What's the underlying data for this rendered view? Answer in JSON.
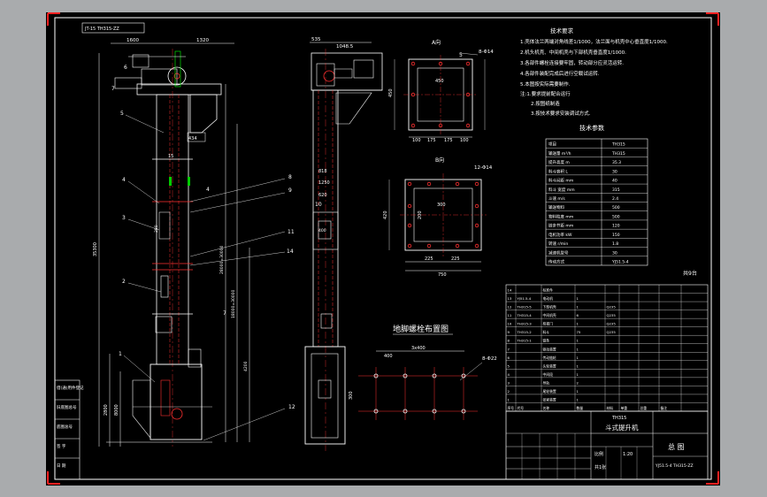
{
  "drawing_code": "JT-15 TH315-ZZ",
  "notes": {
    "title": "技术要求",
    "items": [
      "1.壳体法兰两端对角线差1/1000，法兰面与机壳中心垂直度1/1000.",
      "2.机头机壳、中间机壳与下部机壳垂直度1/1000.",
      "3.各部件螺栓连接要牢固，转动部分应灵活运转.",
      "4.各部件装配完成后进行空载试运转.",
      "5.本图按实际需要制作."
    ],
    "sub_items": [
      "注:1.要求提前配合运行",
      "2.按图纸制造",
      "3.按技术要求安装调试方式."
    ]
  },
  "tech_table": {
    "title": "技术参数",
    "header": [
      "项目",
      "TH315"
    ],
    "rows": [
      [
        "输送量 m³/h",
        "TH315"
      ],
      [
        "提升高度 m",
        "35.3"
      ],
      [
        "料斗容积 L",
        "30"
      ],
      [
        "料斗间距 mm",
        "40"
      ],
      [
        "料斗 宽度 mm",
        "315"
      ],
      [
        "斗速 m/s",
        "2.4"
      ],
      [
        "输送物料",
        "500"
      ],
      [
        "物料粒度 mm",
        "500"
      ],
      [
        "链条节距 mm",
        "120"
      ],
      [
        "电机功率 kW",
        "150"
      ],
      [
        "转速 r/min",
        "1.8"
      ],
      [
        "减速机型号",
        "30"
      ],
      [
        "传动方式",
        "YJ51.5-4"
      ]
    ]
  },
  "view_labels": {
    "a": "A向",
    "b": "B向",
    "anchor": "地脚螺栓布置图"
  },
  "dims": {
    "total": "1600",
    "width": "1320",
    "head_w": "1048.5",
    "head_l": "535",
    "sec_a": "580",
    "sec_b": "434",
    "a_size": "450",
    "a_bot": [
      "100",
      "175",
      "175",
      "100"
    ],
    "b_w": "300",
    "b_h": "200",
    "b_bot": [
      "225",
      "225"
    ],
    "b_total": "750",
    "b_side": "420",
    "anchor_w": "400",
    "anchor_total": "3x400",
    "anchor_h": "300",
    "hole_a": "8-Φ14",
    "hole_b": "12-Φ14",
    "hole_anchor": "8-Φ22",
    "left_h1": "35300",
    "left_h2": "6000",
    "left_h3": "2800",
    "left_h4": "8000",
    "right_v1": "28000=30000",
    "right_v2": "18000=30000",
    "right_v3": "4200",
    "side_620": "620",
    "side_300": "300",
    "side_400": "400",
    "side_818": "818",
    "side_1250": "1250",
    "vert_1": "15",
    "head_dim_375": "375",
    "t_1000": "1000",
    "t_280": "280"
  },
  "callouts": [
    "1",
    "2",
    "3",
    "4",
    "5",
    "6",
    "7",
    "8",
    "9",
    "10",
    "11",
    "12",
    "13",
    "14"
  ],
  "bom": {
    "header": [
      "序号",
      "代号",
      "名称",
      "数量",
      "材料",
      "单重",
      "总重",
      "备注"
    ],
    "rows": [
      [
        "14",
        "",
        "标准件",
        "",
        "",
        "",
        "",
        ""
      ],
      [
        "13",
        "YJ51.5-4",
        "电动机",
        "1",
        "",
        "",
        "",
        ""
      ],
      [
        "12",
        "TH315-5",
        "下部机壳",
        "1",
        "Q235",
        "",
        "",
        ""
      ],
      [
        "11",
        "TH315-4",
        "中间机壳",
        "6",
        "Q235",
        "",
        "",
        ""
      ],
      [
        "10",
        "TH315-3",
        "检视门",
        "1",
        "Q235",
        "",
        "",
        ""
      ],
      [
        "9",
        "TH315-2",
        "料斗",
        "75",
        "Q235",
        "",
        "",
        ""
      ],
      [
        "8",
        "TH315-1",
        "链条",
        "1",
        "",
        "",
        "",
        ""
      ],
      [
        "7",
        "",
        "驱动装置",
        "1",
        "",
        "",
        "",
        ""
      ],
      [
        "6",
        "",
        "传动链轮",
        "1",
        "",
        "",
        "",
        ""
      ],
      [
        "5",
        "",
        "头轮装置",
        "1",
        "",
        "",
        "",
        ""
      ],
      [
        "4",
        "",
        "中间段",
        "1",
        "",
        "",
        "",
        ""
      ],
      [
        "3",
        "",
        "导轨",
        "2",
        "",
        "",
        "",
        ""
      ],
      [
        "2",
        "",
        "尾轮装置",
        "1",
        "",
        "",
        "",
        ""
      ],
      [
        "1",
        "",
        "张紧装置",
        "1",
        "",
        "",
        "",
        ""
      ]
    ],
    "foot": [
      "序号",
      "代号",
      "名称",
      "数量",
      "材料",
      "单重",
      "总重",
      "备注"
    ]
  },
  "title_block": {
    "company": "TH315",
    "name": "斗式提升机",
    "scale_label": "比例",
    "scale": "1:20",
    "sheet": "共1张",
    "drawing": "总 图",
    "code": "YJ51.5-4 TH315-ZZ"
  },
  "left_strip": [
    "借(通)用件登记",
    "旧底图总号",
    "底图总号",
    "签 字",
    "日 期"
  ],
  "sheet_note": "共9台"
}
